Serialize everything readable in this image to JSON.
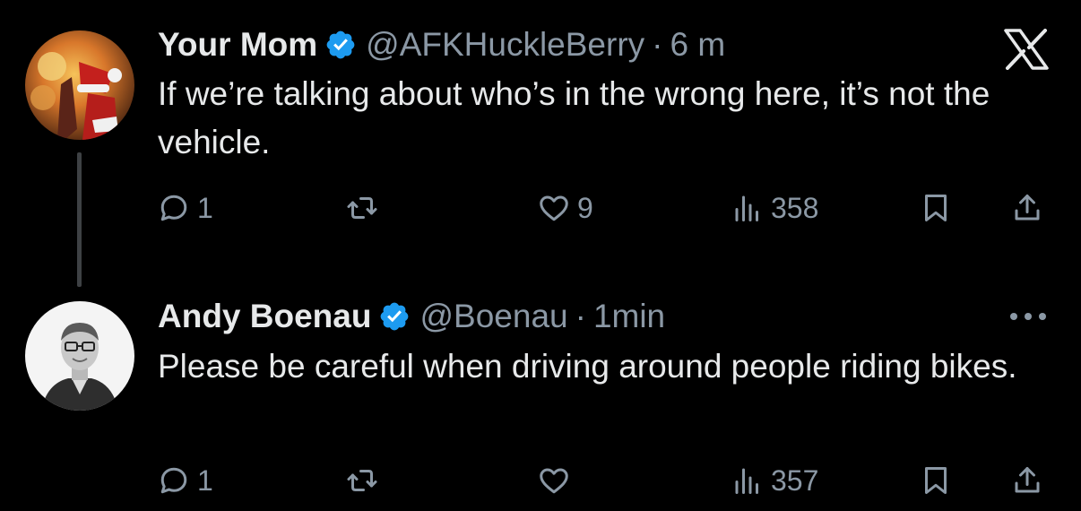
{
  "tweets": [
    {
      "name": "Your Mom",
      "handle": "@AFKHuckleBerry",
      "separator": "·",
      "time": "6 m",
      "text": "If we’re talking about who’s in the wrong here, it’s not the vehicle.",
      "replies": "1",
      "retweets": "",
      "likes": "9",
      "views": "358",
      "avatar_icon": "santa-photo-avatar"
    },
    {
      "name": "Andy Boenau",
      "handle": "@Boenau",
      "separator": "·",
      "time": "1min",
      "text": "Please be careful when driving around people riding bikes.",
      "replies": "1",
      "retweets": "",
      "likes": "",
      "views": "357",
      "avatar_icon": "person-photo-avatar"
    }
  ],
  "colors": {
    "background": "#000000",
    "text": "#e7e9ea",
    "secondary": "#8b98a5",
    "verified": "#1d9bf0",
    "thread_line": "#3e4144"
  },
  "icons": [
    "x-logo-icon",
    "verified-badge-icon",
    "reply-icon",
    "retweet-icon",
    "like-icon",
    "views-icon",
    "bookmark-icon",
    "share-icon",
    "more-options-icon"
  ]
}
